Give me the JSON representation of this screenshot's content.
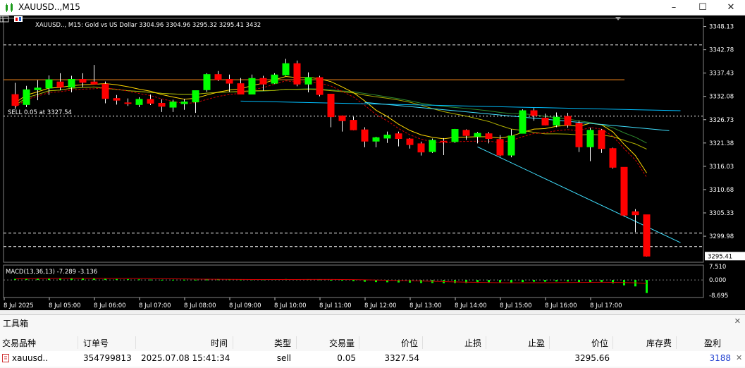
{
  "window": {
    "title": "XAUUSD..,M15",
    "minimize": "–",
    "maximize": "☐",
    "close": "✕"
  },
  "chart": {
    "info_line": "XAUUSD.., M15:  Gold vs US Dollar  3304.96 3304.96 3295.32 3295.41  3432",
    "trade_label": "SELL 0.05 at 3327.54",
    "macd_label": "MACD(13,36,13) -7.289 -3.136",
    "current_price": "3295.41",
    "bull_color": "#00ff00",
    "bear_color": "#ff0000",
    "price_ticks": [
      "3348.13",
      "3342.78",
      "3337.43",
      "3332.08",
      "3326.73",
      "3321.38",
      "3316.03",
      "3310.68",
      "3305.33",
      "3299.98"
    ],
    "macd_ticks": [
      "7.510",
      "0.000",
      "-8.695"
    ],
    "time_labels": [
      "8 Jul 2025",
      "8 Jul 05:00",
      "8 Jul 06:00",
      "8 Jul 07:00",
      "8 Jul 08:00",
      "8 Jul 09:00",
      "8 Jul 10:00",
      "8 Jul 11:00",
      "8 Jul 12:00",
      "8 Jul 13:00",
      "8 Jul 14:00",
      "8 Jul 15:00",
      "8 Jul 16:00",
      "8 Jul 17:00"
    ]
  },
  "chart_data": {
    "type": "candlestick",
    "title": "XAUUSD.., M15: Gold vs US Dollar",
    "ylim": [
      3294,
      3350
    ],
    "candles": [
      [
        3332.5,
        3335.2,
        3329.2,
        3330.0
      ],
      [
        3330.2,
        3334.5,
        3329.6,
        3333.6
      ],
      [
        3333.6,
        3335.8,
        3331.2,
        3334.0
      ],
      [
        3334.0,
        3336.9,
        3332.4,
        3335.9
      ],
      [
        3335.4,
        3337.4,
        3333.5,
        3334.2
      ],
      [
        3334.2,
        3336.8,
        3333.0,
        3336.0
      ],
      [
        3336.0,
        3337.4,
        3334.2,
        3335.3
      ],
      [
        3335.4,
        3339.3,
        3334.9,
        3334.9
      ],
      [
        3334.9,
        3335.5,
        3330.5,
        3331.6
      ],
      [
        3331.6,
        3332.4,
        3330.2,
        3331.2
      ],
      [
        3330.6,
        3331.6,
        3329.9,
        3330.5
      ],
      [
        3330.2,
        3331.9,
        3329.6,
        3331.4
      ],
      [
        3331.4,
        3332.5,
        3330.1,
        3330.5
      ],
      [
        3330.5,
        3331.4,
        3328.5,
        3329.8
      ],
      [
        3329.6,
        3331.3,
        3328.5,
        3330.8
      ],
      [
        3330.4,
        3331.5,
        3329.0,
        3330.8
      ],
      [
        3330.8,
        3333.4,
        3328.3,
        3333.4
      ],
      [
        3333.6,
        3337.4,
        3333.1,
        3337.1
      ],
      [
        3337.1,
        3337.9,
        3335.6,
        3335.9
      ],
      [
        3336.0,
        3337.1,
        3333.1,
        3335.1
      ],
      [
        3335.0,
        3336.3,
        3332.7,
        3332.6
      ],
      [
        3332.6,
        3337.1,
        3332.6,
        3336.2
      ],
      [
        3336.2,
        3336.8,
        3333.4,
        3334.9
      ],
      [
        3335.1,
        3337.4,
        3334.9,
        3337.0
      ],
      [
        3337.0,
        3340.7,
        3336.8,
        3339.6
      ],
      [
        3339.6,
        3340.3,
        3334.4,
        3334.9
      ],
      [
        3334.9,
        3337.6,
        3333.0,
        3336.4
      ],
      [
        3336.4,
        3336.8,
        3332.1,
        3332.5
      ],
      [
        3332.6,
        3332.6,
        3325.0,
        3327.4
      ],
      [
        3327.6,
        3327.7,
        3324.0,
        3326.5
      ],
      [
        3326.6,
        3327.4,
        3324.3,
        3324.4
      ],
      [
        3324.4,
        3325.0,
        3320.4,
        3321.8
      ],
      [
        3321.8,
        3322.8,
        3320.4,
        3322.6
      ],
      [
        3322.5,
        3324.0,
        3321.4,
        3323.2
      ],
      [
        3323.5,
        3324.0,
        3320.6,
        3322.4
      ],
      [
        3322.3,
        3322.5,
        3320.1,
        3321.0
      ],
      [
        3321.2,
        3321.7,
        3318.5,
        3319.3
      ],
      [
        3319.4,
        3322.4,
        3319.1,
        3322.0
      ],
      [
        3321.8,
        3322.5,
        3318.6,
        3321.7
      ],
      [
        3321.7,
        3324.6,
        3321.4,
        3324.5
      ],
      [
        3324.3,
        3324.5,
        3322.1,
        3323.1
      ],
      [
        3322.9,
        3323.9,
        3321.3,
        3323.6
      ],
      [
        3323.5,
        3323.9,
        3321.3,
        3322.4
      ],
      [
        3322.2,
        3323.2,
        3318.3,
        3318.6
      ],
      [
        3318.6,
        3324.5,
        3318.1,
        3323.0
      ],
      [
        3323.6,
        3329.1,
        3323.6,
        3328.8
      ],
      [
        3328.8,
        3329.4,
        3326.5,
        3327.7
      ],
      [
        3327.1,
        3328.1,
        3325.4,
        3325.5
      ],
      [
        3325.5,
        3328.4,
        3325.0,
        3327.3
      ],
      [
        3327.5,
        3328.3,
        3324.9,
        3325.5
      ],
      [
        3325.9,
        3326.5,
        3319.3,
        3320.5
      ],
      [
        3320.5,
        3324.9,
        3317.2,
        3324.3
      ],
      [
        3324.3,
        3324.6,
        3319.1,
        3320.1
      ],
      [
        3320.1,
        3320.3,
        3315.5,
        3315.8
      ],
      [
        3315.8,
        3315.8,
        3304.5,
        3304.8
      ],
      [
        3305.6,
        3306.2,
        3300.9,
        3304.9
      ],
      [
        3304.9,
        3304.9,
        3295.3,
        3295.41
      ]
    ],
    "horizontal_lines": [
      {
        "price": 3335.9,
        "color": "#ff8c1a",
        "style": "solid"
      },
      {
        "price": 3343.9,
        "color": "#ffffff",
        "style": "dashed"
      },
      {
        "price": 3327.54,
        "color": "#ffffff",
        "style": "dotted"
      },
      {
        "price": 3300.7,
        "color": "#ffffff",
        "style": "dashed"
      },
      {
        "price": 3297.6,
        "color": "#ffffff",
        "style": "dashed"
      }
    ],
    "trend_lines": [
      {
        "from": [
          20,
          3331.0
        ],
        "to": [
          59,
          3328.8
        ],
        "color": "#00bfff"
      },
      {
        "from": [
          41,
          3320.5
        ],
        "to": [
          59,
          3298.5
        ],
        "color": "#40e0ff"
      },
      {
        "from": [
          31,
          3330.7
        ],
        "to": [
          58,
          3324.2
        ],
        "color": "#40e0ff"
      }
    ],
    "macd": {
      "ylim": [
        -9,
        7.5
      ],
      "histogram": [
        0.6,
        0.8,
        0.9,
        1.0,
        1.0,
        1.1,
        1.0,
        0.9,
        0.6,
        0.5,
        0.4,
        0.3,
        0.2,
        0.1,
        0.1,
        0.1,
        0.1,
        0.2,
        0.3,
        0.3,
        0.2,
        0.3,
        0.3,
        0.4,
        0.5,
        0.4,
        0.4,
        0.3,
        -0.1,
        -0.4,
        -0.7,
        -1.0,
        -1.2,
        -1.3,
        -1.4,
        -1.5,
        -1.7,
        -1.7,
        -1.8,
        -1.7,
        -1.7,
        -1.6,
        -1.6,
        -1.7,
        -1.6,
        -1.2,
        -1.0,
        -1.0,
        -0.9,
        -0.9,
        -1.2,
        -1.2,
        -1.4,
        -1.9,
        -3.0,
        -3.6,
        -7.289
      ],
      "signal": -3.136
    }
  },
  "toolbox": {
    "title": "工具箱",
    "columns": [
      "交易品种",
      "订单号",
      "时间",
      "类型",
      "交易量",
      "价位",
      "止损",
      "止盈",
      "价位",
      "库存费",
      "盈利"
    ],
    "rows": [
      [
        "xauusd..",
        "354799813",
        "2025.07.08 15:41:34",
        "sell",
        "0.05",
        "3327.54",
        "",
        "",
        "3295.66",
        "",
        "3188"
      ]
    ],
    "profit_color": "#2040d0"
  }
}
